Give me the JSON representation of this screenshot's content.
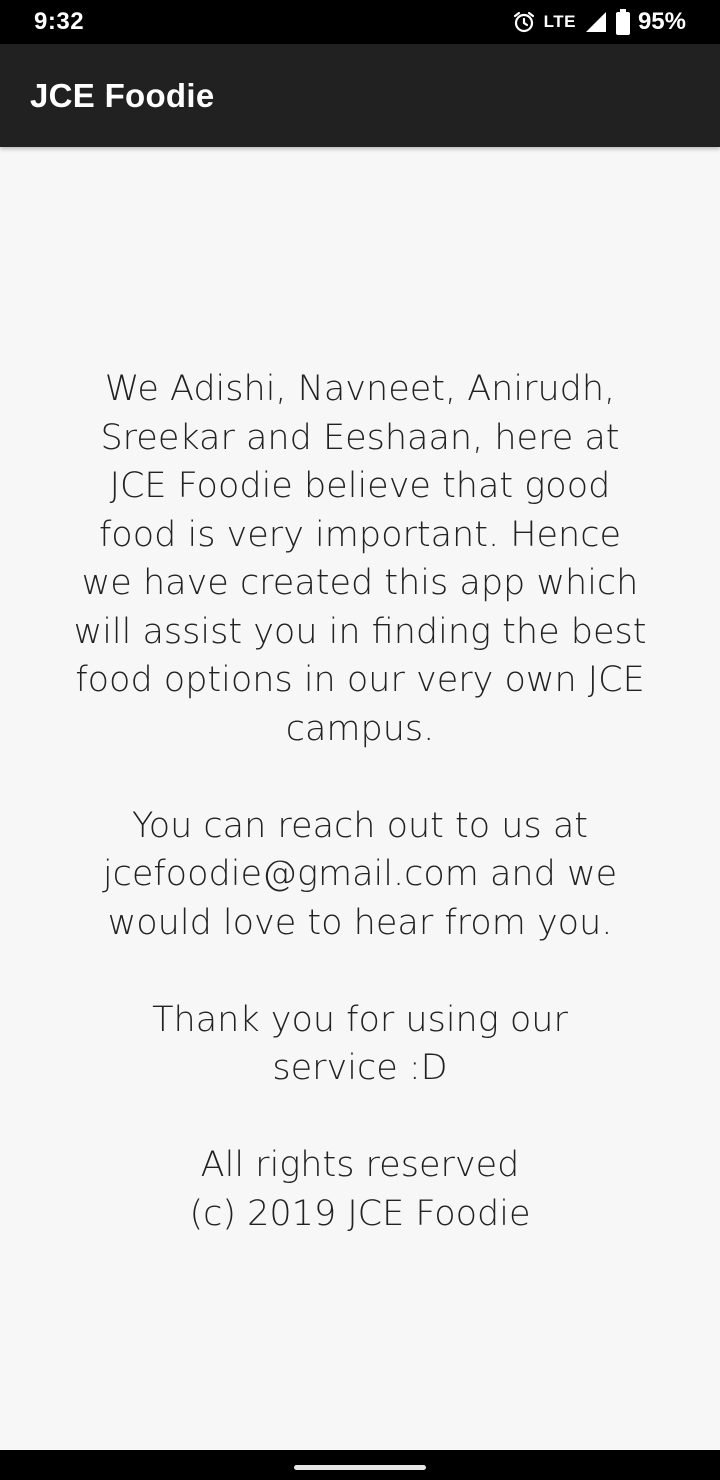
{
  "status_bar": {
    "time": "9:32",
    "network_label": "LTE",
    "battery": "95%",
    "icons": [
      "alarm-icon",
      "signal-icon",
      "battery-icon"
    ]
  },
  "app_bar": {
    "title": "JCE Foodie"
  },
  "about": {
    "paragraph_1_lines": [
      "We Adishi, Navneet, Anirudh,",
      "Sreekar and Eeshaan, here at",
      "JCE Foodie believe that good",
      "food is very important. Hence",
      "we have created this app which",
      "will assist you in finding the best",
      "food options in our very own JCE",
      "campus."
    ],
    "paragraph_2_lines": [
      "You can reach out to us at",
      "jcefoodie@gmail.com and we",
      "would love to hear from you."
    ],
    "paragraph_3_lines": [
      "Thank you for using our",
      "service :D"
    ],
    "paragraph_4_lines": [
      "All rights reserved",
      "(c) 2019 JCE Foodie"
    ]
  },
  "colors": {
    "status_bar_bg": "#000000",
    "app_bar_bg": "#212121",
    "page_bg": "#f7f7f7",
    "text": "#222222"
  }
}
